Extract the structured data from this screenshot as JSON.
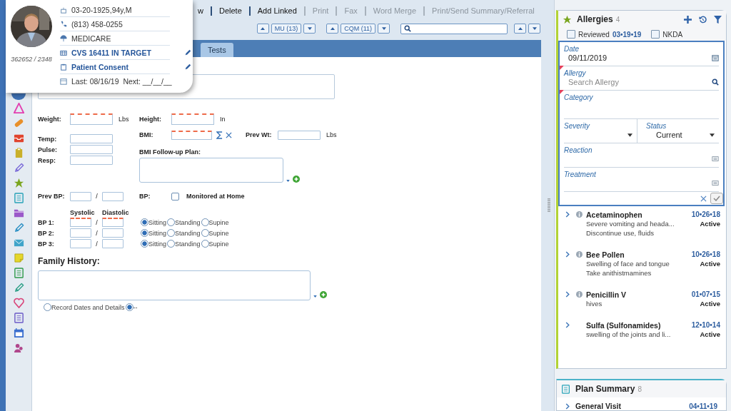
{
  "patient": {
    "id": "362652 / 2348",
    "dob": "03-20-1925,94y,M",
    "phone": "(813) 458-0255",
    "insurance": "MEDICARE",
    "pharmacy": "CVS 16411 IN TARGET",
    "consent": "Patient Consent",
    "visits": "Last: 08/16/19  Next: __/__/__"
  },
  "toolbar": [
    {
      "label": "w",
      "disabled": false
    },
    {
      "label": "Delete",
      "disabled": false
    },
    {
      "label": "Add Linked",
      "disabled": false
    },
    {
      "label": "Print",
      "disabled": true
    },
    {
      "label": "Fax",
      "disabled": true
    },
    {
      "label": "Word Merge",
      "disabled": true
    },
    {
      "label": "Print/Send Summary/Referral",
      "disabled": true
    }
  ],
  "navigators": [
    {
      "label": "MU (13)"
    },
    {
      "label": "CQM (11)"
    }
  ],
  "tabs": [
    {
      "label": "Tests",
      "selected": false
    }
  ],
  "vitals": {
    "weight": {
      "label": "Weight:",
      "unit": "Lbs",
      "required": true
    },
    "height": {
      "label": "Height:",
      "unit": "In",
      "required": true
    },
    "temp": {
      "label": "Temp:",
      "required": false
    },
    "pulse": {
      "label": "Pulse:",
      "required": false
    },
    "resp": {
      "label": "Resp:",
      "required": false
    },
    "bmi": {
      "label": "BMI:",
      "required": true
    },
    "prev_wt": {
      "label": "Prev Wt:",
      "unit": "Lbs"
    },
    "bmi_plan": {
      "label": "BMI Follow-up Plan:"
    },
    "prev_bp": {
      "label": "Prev BP:",
      "separator": "/"
    },
    "bp": {
      "label": "BP:",
      "monitored": {
        "label": "Monitored at Home",
        "checked": false
      }
    },
    "bp_headers": [
      "Systolic",
      "Diastolic"
    ],
    "bp_rows": [
      {
        "label": "BP 1:",
        "separator": "/",
        "required": true,
        "positions": [
          {
            "label": "Sitting",
            "selected": true
          },
          {
            "label": "Standing",
            "selected": false
          },
          {
            "label": "Supine",
            "selected": false
          }
        ]
      },
      {
        "label": "BP 2:",
        "separator": "/",
        "required": false,
        "positions": [
          {
            "label": "Sitting",
            "selected": true
          },
          {
            "label": "Standing",
            "selected": false
          },
          {
            "label": "Supine",
            "selected": false
          }
        ]
      },
      {
        "label": "BP 3:",
        "separator": "/",
        "required": false,
        "positions": [
          {
            "label": "Sitting",
            "selected": true
          },
          {
            "label": "Standing",
            "selected": false
          },
          {
            "label": "Supine",
            "selected": false
          }
        ]
      }
    ]
  },
  "family_history": {
    "title": "Family History:",
    "options": [
      {
        "label": "Record Dates and Details",
        "selected": false
      },
      {
        "label": "--",
        "selected": true
      }
    ]
  },
  "allergies": {
    "title": "Allergies",
    "count": "4",
    "reviewed": {
      "label": "Reviewed",
      "checked": false,
      "date": "03•19•19"
    },
    "nkda": {
      "label": "NKDA",
      "checked": false
    },
    "form": {
      "date": {
        "label": "Date",
        "value": "09/11/2019"
      },
      "allergy": {
        "label": "Allergy",
        "placeholder": "Search Allergy",
        "required": true
      },
      "category": {
        "label": "Category",
        "required": true
      },
      "severity": {
        "label": "Severity"
      },
      "status": {
        "label": "Status",
        "value": "Current"
      },
      "reaction": {
        "label": "Reaction"
      },
      "treatment": {
        "label": "Treatment"
      }
    },
    "items": [
      {
        "name": "Acetaminophen",
        "info": true,
        "lines": [
          "Severe vomiting and heada...",
          "Discontinue use, fluids"
        ],
        "date": "10•26•18",
        "status": "Active"
      },
      {
        "name": "Bee Pollen",
        "info": true,
        "lines": [
          "Swelling of face and tongue",
          "Take anithistmamines"
        ],
        "date": "10•26•18",
        "status": "Active"
      },
      {
        "name": "Penicillin V",
        "info": true,
        "lines": [
          "hives"
        ],
        "date": "01•07•15",
        "status": "Active"
      },
      {
        "name": "Sulfa (Sulfonamides)",
        "info": false,
        "lines": [
          "swelling of the joints and li..."
        ],
        "date": "12•10•14",
        "status": "Active"
      }
    ]
  },
  "plan_summary": {
    "title": "Plan Summary",
    "count": "8",
    "items": [
      {
        "name": "General Visit",
        "date": "04•11•19"
      }
    ]
  }
}
